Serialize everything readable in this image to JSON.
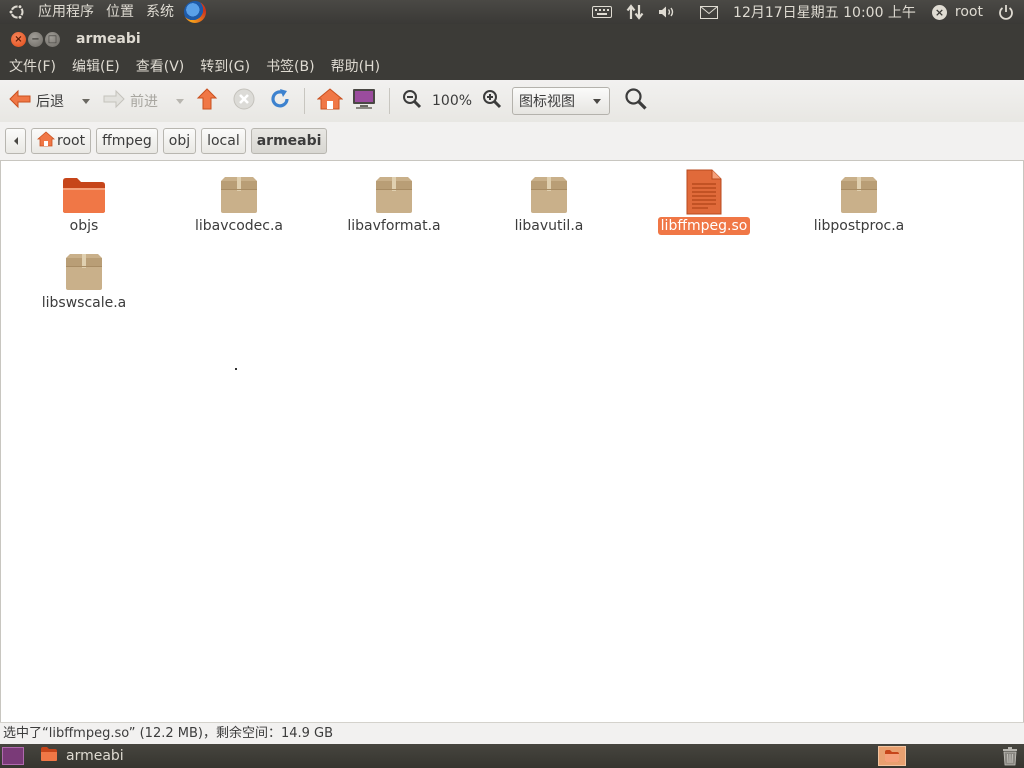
{
  "top_panel": {
    "menus": [
      "应用程序",
      "位置",
      "系统"
    ],
    "clock": "12月17日星期五 10:00 上午",
    "user": "root"
  },
  "window": {
    "title": "armeabi"
  },
  "menubar": {
    "items": [
      "文件(F)",
      "编辑(E)",
      "查看(V)",
      "转到(G)",
      "书签(B)",
      "帮助(H)"
    ]
  },
  "toolbar": {
    "back_label": "后退",
    "forward_label": "前进",
    "zoom_level": "100%",
    "view_mode": "图标视图"
  },
  "pathbar": {
    "crumbs": [
      "root",
      "ffmpeg",
      "obj",
      "local",
      "armeabi"
    ]
  },
  "files": [
    {
      "name": "objs",
      "type": "folder"
    },
    {
      "name": "libavcodec.a",
      "type": "archive"
    },
    {
      "name": "libavformat.a",
      "type": "archive"
    },
    {
      "name": "libavutil.a",
      "type": "archive"
    },
    {
      "name": "libffmpeg.so",
      "type": "document",
      "selected": true
    },
    {
      "name": "libpostproc.a",
      "type": "archive"
    },
    {
      "name": "libswscale.a",
      "type": "archive"
    }
  ],
  "statusbar": {
    "text": "选中了“libffmpeg.so” (12.2 MB)，剩余空间：14.9 GB"
  },
  "bottom_panel": {
    "task_label": "armeabi"
  },
  "colors": {
    "accent": "#f07746",
    "panel": "#3c3b37"
  }
}
